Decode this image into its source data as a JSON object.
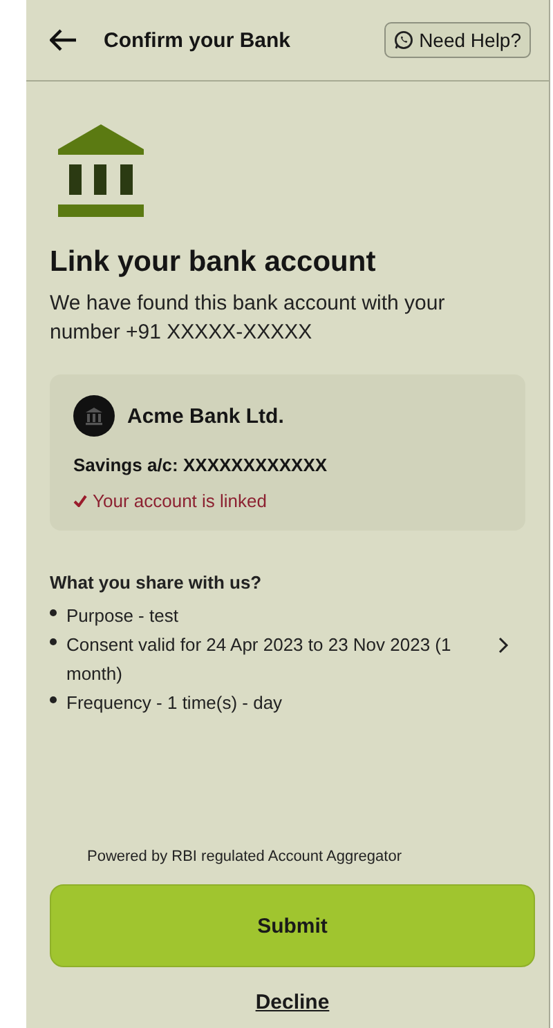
{
  "header": {
    "title": "Confirm your Bank",
    "help_button": "Need Help?"
  },
  "heading": "Link your bank account",
  "description": "We have found this bank account with your number +91 XXXXX-XXXXX",
  "account": {
    "bank_name": "Acme Bank Ltd.",
    "account_number": "Savings a/c: XXXXXXXXXXXX",
    "linked": true,
    "status": "Your account is linked"
  },
  "share": {
    "title": "What you share with us?",
    "items": [
      {
        "text": "Purpose - test",
        "expandable": false
      },
      {
        "text": "Consent valid for 24 Apr 2023 to 23 Nov 2023 (1 month)",
        "expandable": true
      },
      {
        "text": "Frequency - 1 time(s) - day",
        "expandable": false
      }
    ]
  },
  "powered_by": "Powered by RBI regulated Account Aggregator",
  "buttons": {
    "submit": "Submit",
    "decline": "Decline"
  }
}
